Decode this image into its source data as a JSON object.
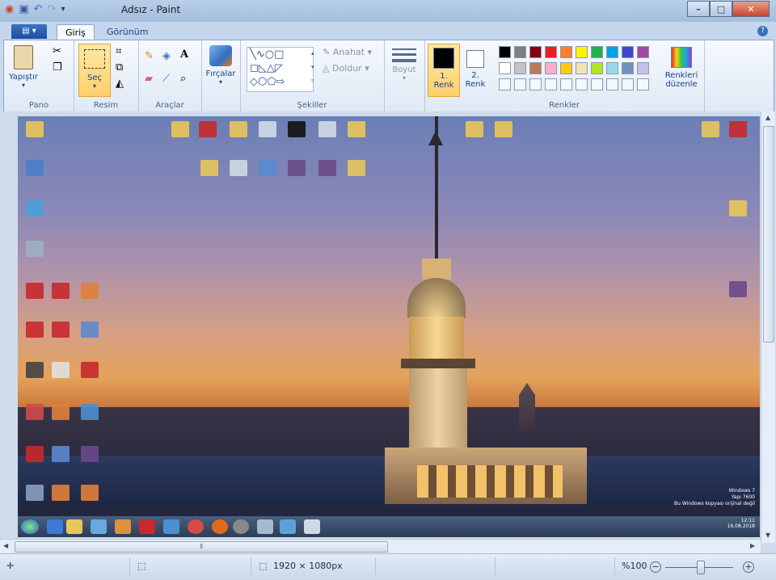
{
  "window": {
    "title": "Adsız - Paint",
    "controls": {
      "minimize": "–",
      "maximize": "□",
      "close": "✕"
    }
  },
  "tabs": [
    {
      "label": "Giriş",
      "active": true
    },
    {
      "label": "Görünüm",
      "active": false
    }
  ],
  "ribbon": {
    "pano": {
      "label": "Pano",
      "paste": "Yapıştır"
    },
    "resim": {
      "label": "Resim",
      "select": "Seç"
    },
    "araclar": {
      "label": "Araçlar"
    },
    "fircalar": {
      "label": "Fırçalar"
    },
    "sekiller": {
      "label": "Şekiller",
      "outline": "Anahat",
      "fill": "Doldur"
    },
    "boyut": {
      "label": "Boyut"
    },
    "renk1": {
      "label_line1": "1.",
      "label_line2": "Renk"
    },
    "renk2": {
      "label_line1": "2.",
      "label_line2": "Renk"
    },
    "renkler": {
      "label": "Renkler"
    },
    "edit_colors": {
      "line1": "Renkleri",
      "line2": "düzenle"
    },
    "palette_row1": [
      "#000000",
      "#7f7f7f",
      "#880015",
      "#ed1c24",
      "#ff7f27",
      "#fff200",
      "#22b14c",
      "#00a2e8",
      "#3f48cc",
      "#a349a4"
    ],
    "palette_row2": [
      "#ffffff",
      "#c3c3c3",
      "#b97a57",
      "#ffaec9",
      "#ffc90e",
      "#efe4b0",
      "#b5e61d",
      "#99d9ea",
      "#7092be",
      "#c8bfe7"
    ]
  },
  "desktop": {
    "watermark_line1": "Windows 7",
    "watermark_line2": "Yapı 7600",
    "watermark_line3": "Bu Windows kopyası orijinal değil",
    "clock_time": "12:11",
    "clock_date": "16.08.2018"
  },
  "status": {
    "canvas_size": "1920 × 1080px",
    "zoom": "%100",
    "zoom_fraction": 0.5
  }
}
